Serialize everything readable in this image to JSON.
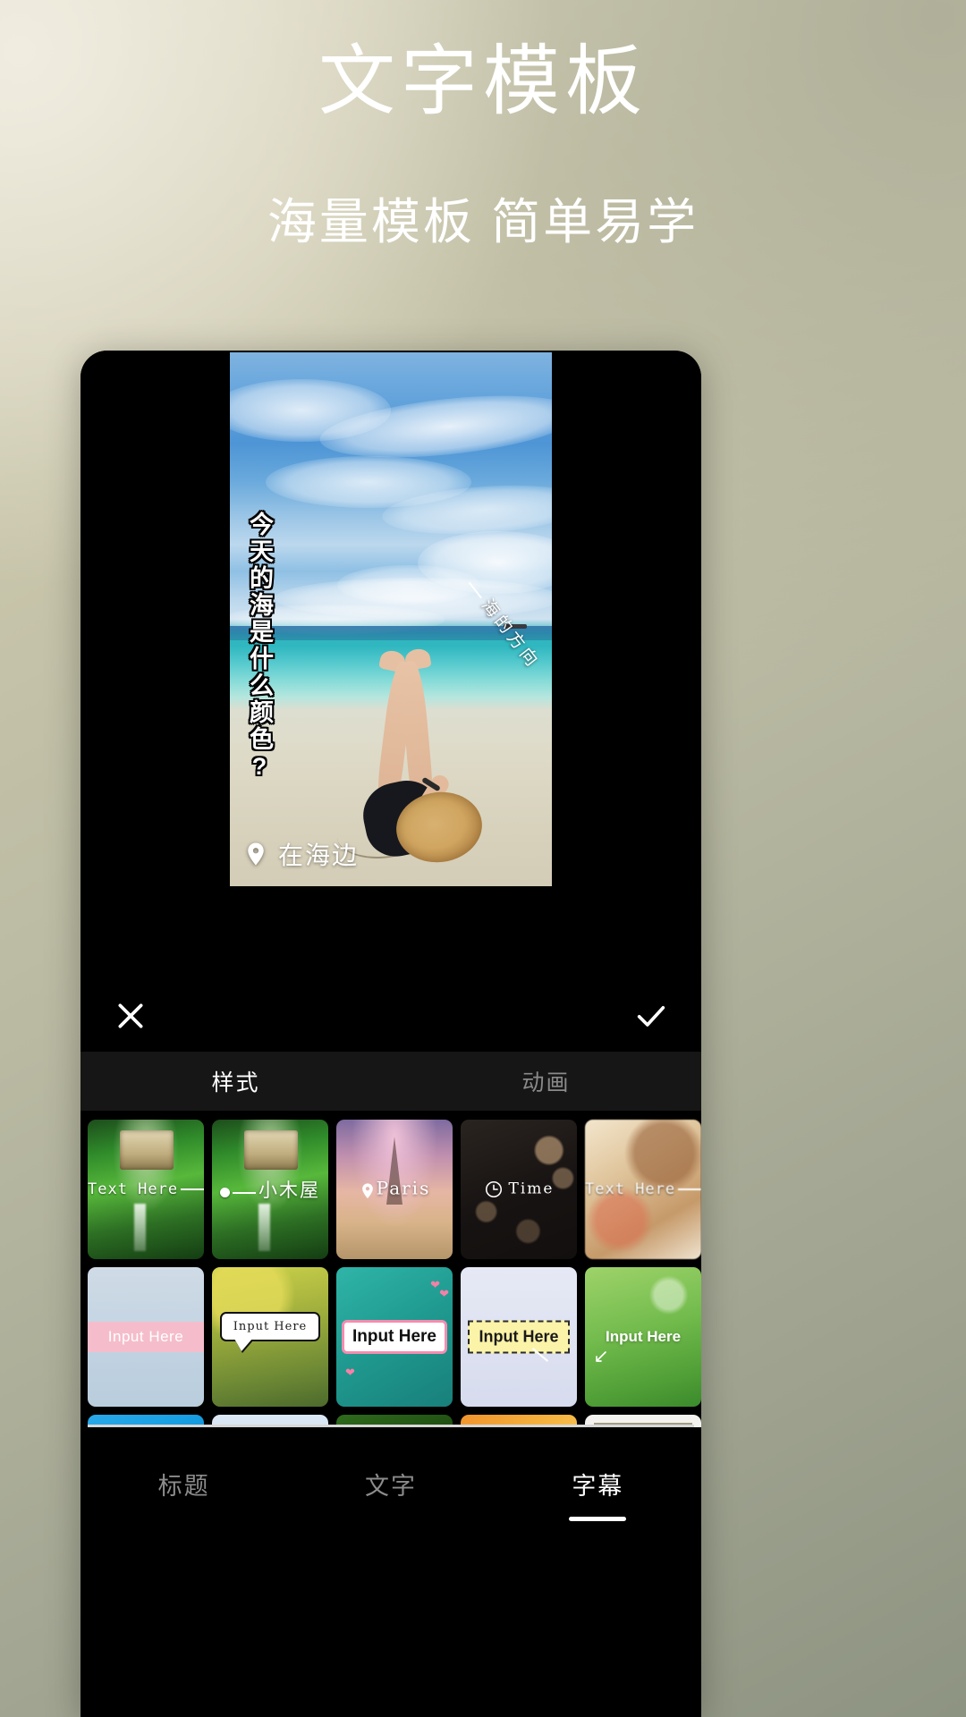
{
  "promo": {
    "title": "文字模板",
    "subtitle": "海量模板 简单易学"
  },
  "preview": {
    "vertical_caption": "今天的海是什么颜色?",
    "diagonal_caption": "海的方向",
    "location_caption": "在海边",
    "location_icon": "location-pin-icon"
  },
  "action_bar": {
    "cancel_icon": "close-x-icon",
    "confirm_icon": "check-icon"
  },
  "mode_tabs": [
    {
      "label": "样式",
      "active": true
    },
    {
      "label": "动画",
      "active": false
    }
  ],
  "templates": {
    "row1": [
      {
        "caption": "Text Here",
        "style": "mono-line-right"
      },
      {
        "caption": "小木屋",
        "style": "cn-line-left"
      },
      {
        "caption": "Paris",
        "style": "paris-pin"
      },
      {
        "caption": "Time",
        "style": "clock"
      },
      {
        "caption": "Text Here",
        "style": "mono-line-right"
      }
    ],
    "row2": [
      {
        "caption": "Input Here",
        "style": "pink-band"
      },
      {
        "caption": "Input Here",
        "style": "white-bubble"
      },
      {
        "caption": "Input Here",
        "style": "pink-bubble"
      },
      {
        "caption": "Input Here",
        "style": "dashed-yellow"
      },
      {
        "caption": "Input Here",
        "style": "green-plain"
      }
    ],
    "row3": [
      {
        "caption": "",
        "style": "blue-sky"
      },
      {
        "caption": "",
        "style": "pale-blue"
      },
      {
        "caption": "",
        "style": "dark-green"
      },
      {
        "caption": "",
        "style": "orange"
      },
      {
        "caption": "",
        "style": "white-card"
      }
    ]
  },
  "bottom_nav": [
    {
      "label": "标题",
      "active": false
    },
    {
      "label": "文字",
      "active": false
    },
    {
      "label": "字幕",
      "active": true
    }
  ],
  "colors": {
    "accent_white": "#ffffff",
    "panel_black": "#000000",
    "tab_bar": "#161616",
    "inactive_text": "#8a8a8a"
  }
}
